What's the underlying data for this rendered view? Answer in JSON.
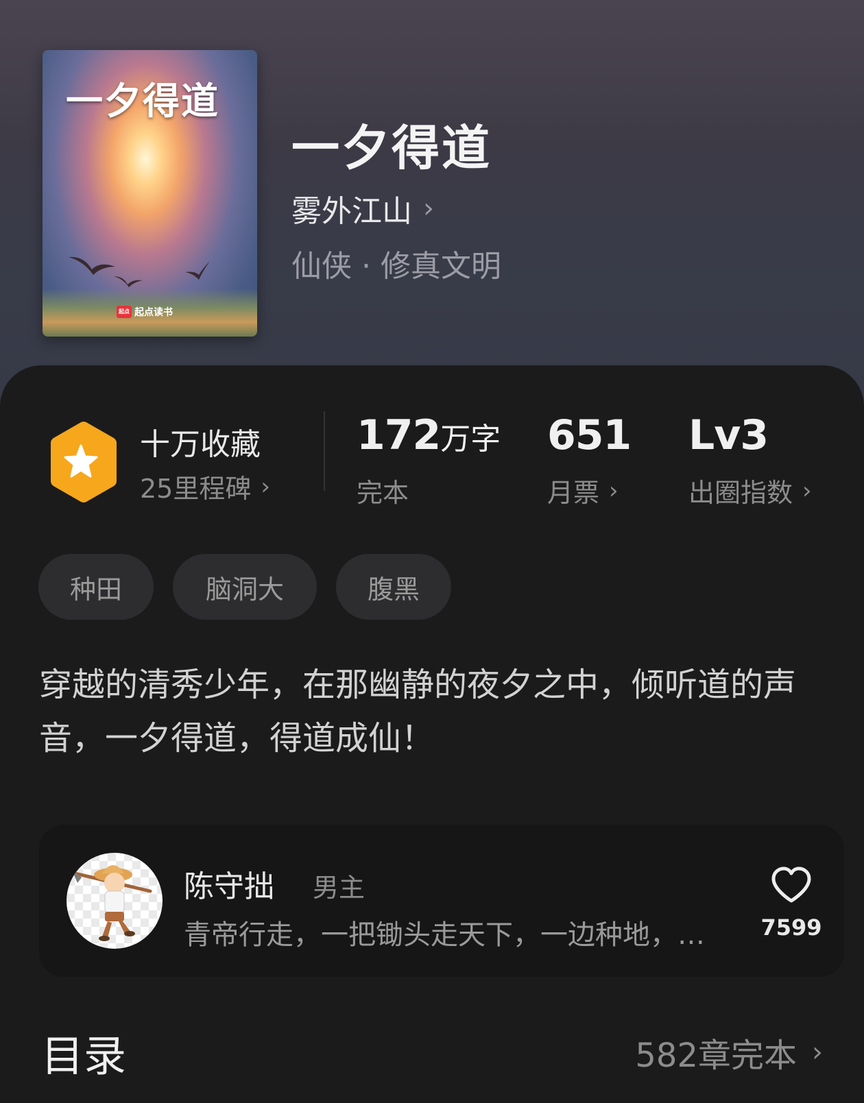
{
  "book": {
    "cover_title": "一夕得道",
    "cover_logo": "起点读书",
    "title": "一夕得道",
    "author": "雾外江山",
    "genre": "仙侠 · 修真文明"
  },
  "stats": {
    "collect_label": "十万收藏",
    "milestone": "25里程碑",
    "words_value": "172",
    "words_unit": "万字",
    "words_label": "完本",
    "monthly_value": "651",
    "monthly_label": "月票",
    "index_value": "Lv3",
    "index_label": "出圈指数"
  },
  "tags": [
    "种田",
    "脑洞大",
    "腹黑"
  ],
  "description": "穿越的清秀少年，在那幽静的夜夕之中，倾听道的声音，一夕得道，得道成仙！",
  "character": {
    "name": "陈守拙",
    "role": "男主",
    "summary": "青帝行走，一把锄头走天下，一边种地，一边修行",
    "likes": "7599"
  },
  "toc": {
    "title": "目录",
    "count": "582章完本"
  },
  "icons": {
    "milestone_badge": "star-hexagon-icon",
    "chevron": "chevron-right-icon",
    "like": "heart-icon"
  },
  "colors": {
    "badge": "#f6a71c",
    "background": "#1b1b1c"
  }
}
